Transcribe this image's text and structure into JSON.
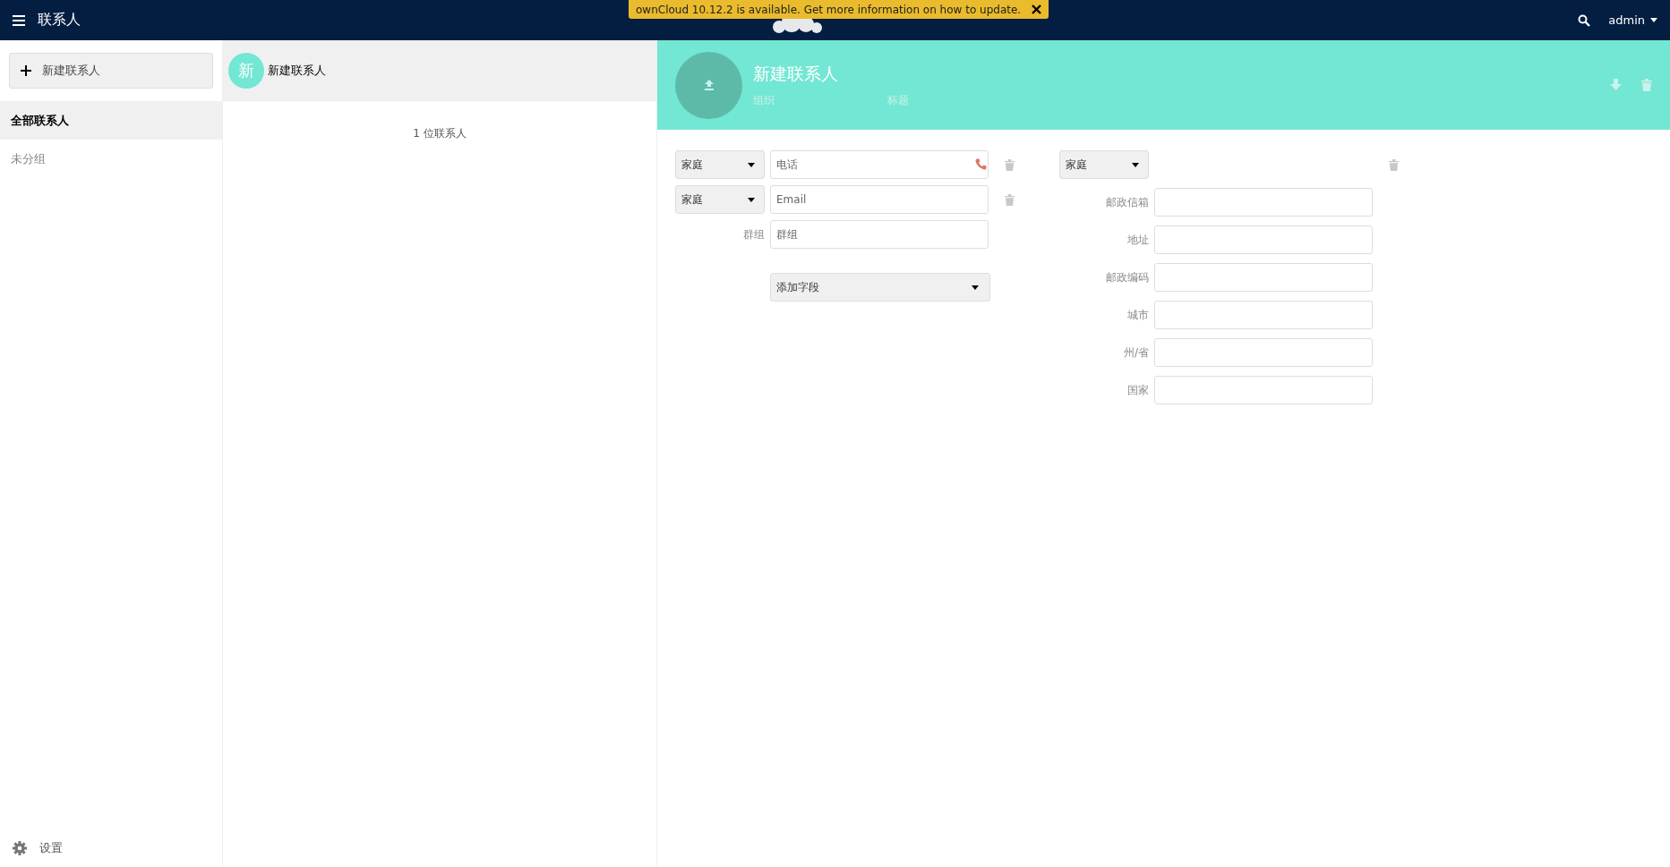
{
  "topbar": {
    "app_title": "联系人",
    "notification": "ownCloud 10.12.2 is available. Get more information on how to update.",
    "user": "admin"
  },
  "sidebar": {
    "new_button": "新建联系人",
    "groups": [
      {
        "label": "全部联系人",
        "selected": true
      },
      {
        "label": "未分组",
        "selected": false
      }
    ],
    "settings": "设置"
  },
  "contact_list": {
    "items": [
      {
        "initial": "新",
        "name": "新建联系人",
        "selected": true,
        "color": "#72e7d3"
      }
    ],
    "count": "1 位联系人"
  },
  "detail": {
    "name": "新建联系人",
    "org_placeholder": "组织",
    "title_placeholder": "标题",
    "fields": [
      {
        "kind": "phone",
        "type": "家庭",
        "placeholder": "电话"
      },
      {
        "kind": "email",
        "type": "家庭",
        "placeholder": "Email"
      },
      {
        "kind": "labeled",
        "label": "群组",
        "placeholder": "群组"
      }
    ],
    "add_field": "添加字段",
    "address": {
      "type": "家庭",
      "fields": [
        {
          "label": "邮政信箱"
        },
        {
          "label": "地址"
        },
        {
          "label": "邮政编码"
        },
        {
          "label": "城市"
        },
        {
          "label": "州/省"
        },
        {
          "label": "国家"
        }
      ]
    }
  }
}
